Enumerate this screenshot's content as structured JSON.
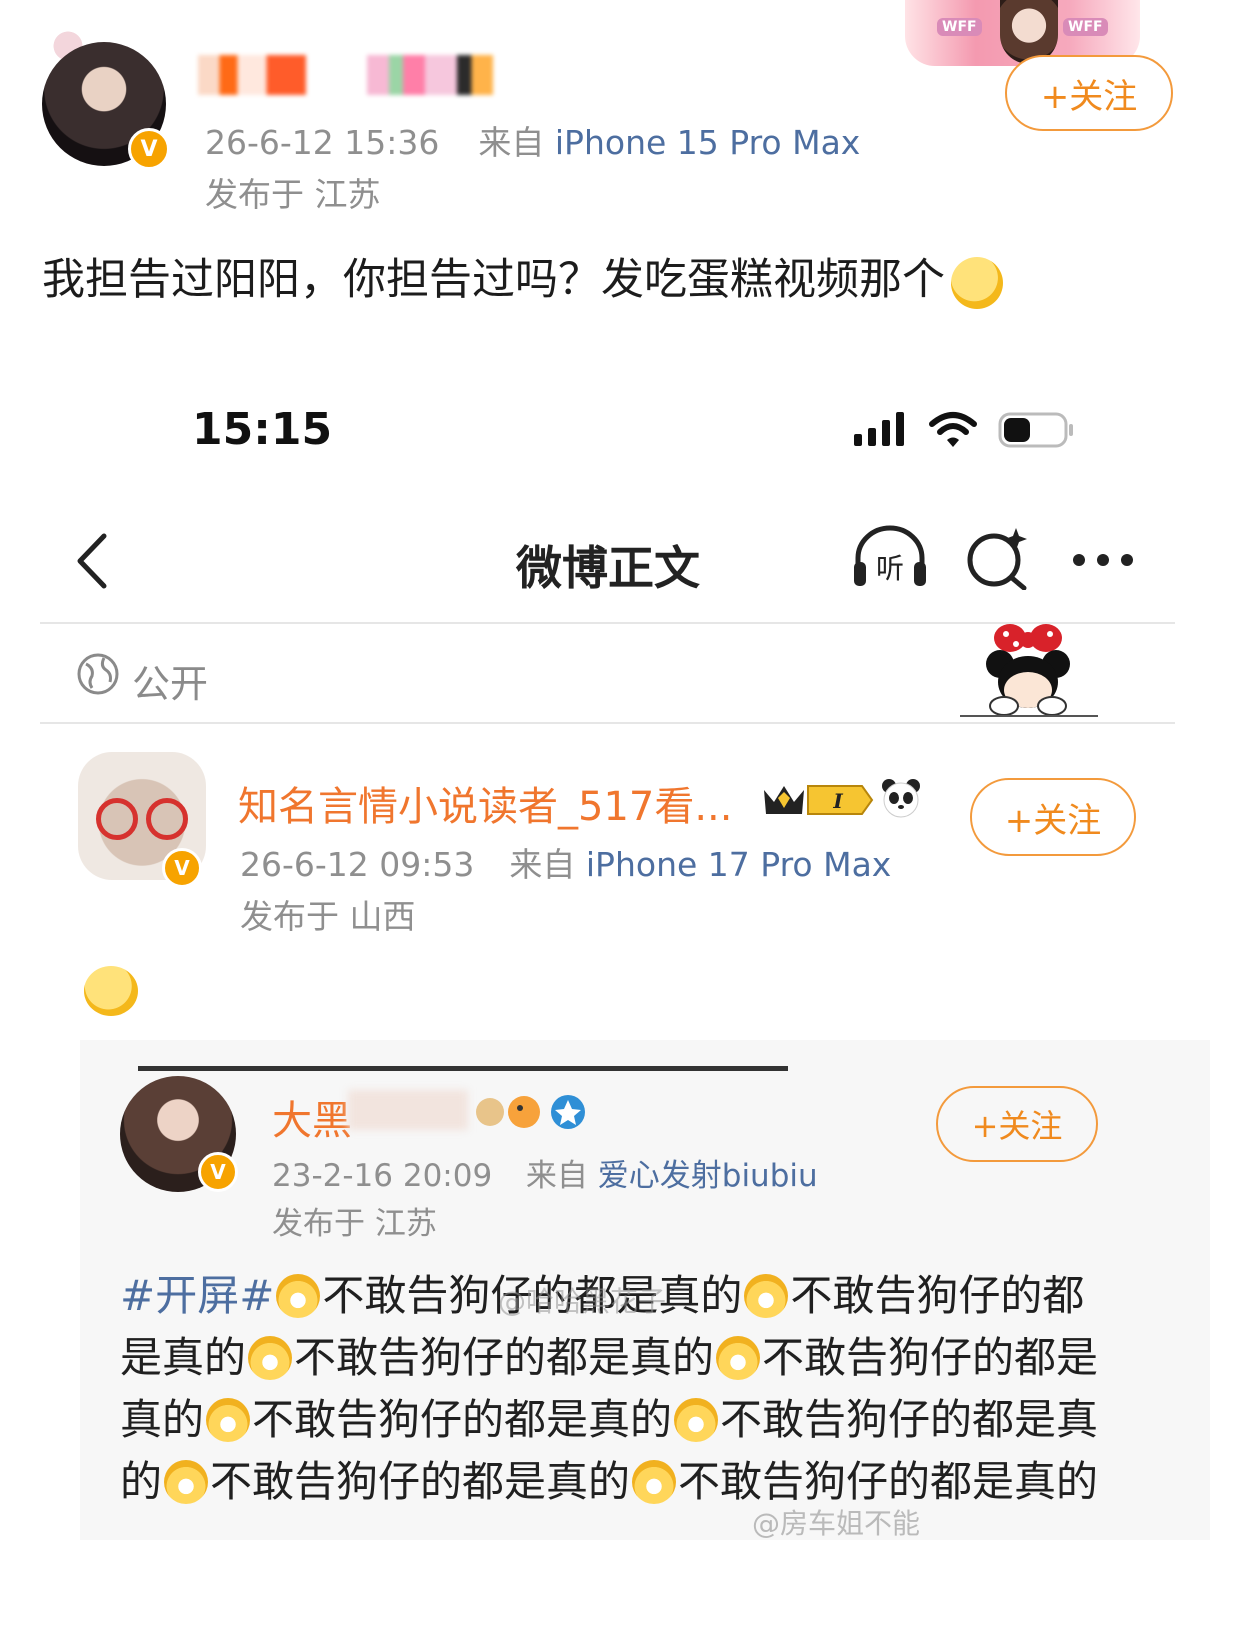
{
  "outer_post": {
    "timestamp": "26-6-12 15:36",
    "source_prefix": "来自",
    "device": "iPhone 15 Pro Max",
    "location": "发布于 江苏",
    "follow_label": "+关注",
    "text": "我担告过阳阳，你担告过吗？发吃蛋糕视频那个",
    "banner_tag": "WFF"
  },
  "status_bar": {
    "time": "15:15"
  },
  "nav": {
    "title": "微博正文",
    "listen_label": "听"
  },
  "visibility": {
    "label": "公开"
  },
  "quoted_post": {
    "author": "知名言情小说读者_517看...",
    "level_badge": "I",
    "timestamp": "26-6-12 09:53",
    "source_prefix": "来自",
    "device": "iPhone 17 Pro Max",
    "location": "发布于 山西",
    "follow_label": "+关注"
  },
  "nested_post": {
    "author_visible": "大黑",
    "timestamp": "23-2-16 20:09",
    "source_prefix": "来自",
    "device": "爱心发射biubiu",
    "location": "发布于 江苏",
    "follow_label": "+关注",
    "hashtag": "#开屏#",
    "phrase": "不敢告狗仔的都是真的",
    "watermark": "@哈哈黑花子",
    "bottom_watermark": "@房车姐不能"
  },
  "colors": {
    "accent_orange": "#f08a1e",
    "link_blue": "#4d6ea0",
    "meta_gray": "#8f8f8f",
    "vip_badge": "#f7a300"
  }
}
